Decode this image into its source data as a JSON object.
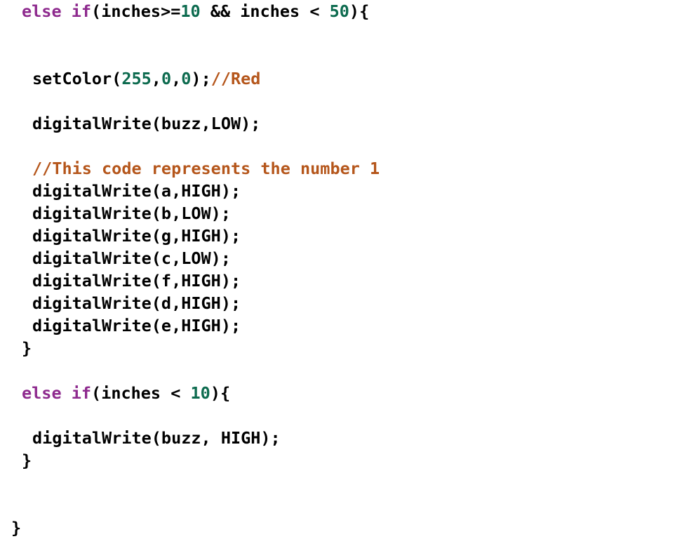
{
  "document": {
    "kind": "source-code-listing",
    "language": "arduino-c",
    "background_color": "#ffffff",
    "palette": {
      "keyword": "#8e2a8e",
      "number": "#0d6b4f",
      "comment": "#b5561b",
      "plain": "#000000"
    }
  },
  "code": {
    "lines": [
      {
        "id": "line-1",
        "indent": 1,
        "tokens": [
          {
            "type": "kw",
            "text": "else"
          },
          {
            "type": "plain",
            "text": " "
          },
          {
            "type": "kw",
            "text": "if"
          },
          {
            "type": "plain",
            "text": "(inches>="
          },
          {
            "type": "num",
            "text": "10"
          },
          {
            "type": "plain",
            "text": " && inches < "
          },
          {
            "type": "num",
            "text": "50"
          },
          {
            "type": "plain",
            "text": "){"
          }
        ]
      },
      {
        "id": "line-2",
        "indent": 0,
        "blank": true,
        "tokens": []
      },
      {
        "id": "line-3",
        "indent": 0,
        "blank": true,
        "tokens": []
      },
      {
        "id": "line-4",
        "indent": 2,
        "tokens": [
          {
            "type": "plain",
            "text": "setColor("
          },
          {
            "type": "num",
            "text": "255"
          },
          {
            "type": "plain",
            "text": ","
          },
          {
            "type": "num",
            "text": "0"
          },
          {
            "type": "plain",
            "text": ","
          },
          {
            "type": "num",
            "text": "0"
          },
          {
            "type": "plain",
            "text": ");"
          },
          {
            "type": "comment",
            "text": "//Red"
          }
        ]
      },
      {
        "id": "line-5",
        "indent": 0,
        "blank": true,
        "tokens": []
      },
      {
        "id": "line-6",
        "indent": 2,
        "tokens": [
          {
            "type": "plain",
            "text": "digitalWrite(buzz,LOW);"
          }
        ]
      },
      {
        "id": "line-7",
        "indent": 0,
        "blank": true,
        "tokens": []
      },
      {
        "id": "line-8",
        "indent": 2,
        "tokens": [
          {
            "type": "comment",
            "text": "//This code represents the number 1"
          }
        ]
      },
      {
        "id": "line-9",
        "indent": 2,
        "tokens": [
          {
            "type": "plain",
            "text": "digitalWrite(a,HIGH);"
          }
        ]
      },
      {
        "id": "line-10",
        "indent": 2,
        "tokens": [
          {
            "type": "plain",
            "text": "digitalWrite(b,LOW);"
          }
        ]
      },
      {
        "id": "line-11",
        "indent": 2,
        "tokens": [
          {
            "type": "plain",
            "text": "digitalWrite(g,HIGH);"
          }
        ]
      },
      {
        "id": "line-12",
        "indent": 2,
        "tokens": [
          {
            "type": "plain",
            "text": "digitalWrite(c,LOW);"
          }
        ]
      },
      {
        "id": "line-13",
        "indent": 2,
        "tokens": [
          {
            "type": "plain",
            "text": "digitalWrite(f,HIGH);"
          }
        ]
      },
      {
        "id": "line-14",
        "indent": 2,
        "tokens": [
          {
            "type": "plain",
            "text": "digitalWrite(d,HIGH);"
          }
        ]
      },
      {
        "id": "line-15",
        "indent": 2,
        "tokens": [
          {
            "type": "plain",
            "text": "digitalWrite(e,HIGH);"
          }
        ]
      },
      {
        "id": "line-16",
        "indent": 1,
        "tokens": [
          {
            "type": "plain",
            "text": "}"
          }
        ]
      },
      {
        "id": "line-17",
        "indent": 0,
        "blank": true,
        "tokens": []
      },
      {
        "id": "line-18",
        "indent": 1,
        "tokens": [
          {
            "type": "kw",
            "text": "else"
          },
          {
            "type": "plain",
            "text": " "
          },
          {
            "type": "kw",
            "text": "if"
          },
          {
            "type": "plain",
            "text": "(inches < "
          },
          {
            "type": "num",
            "text": "10"
          },
          {
            "type": "plain",
            "text": "){"
          }
        ]
      },
      {
        "id": "line-19",
        "indent": 0,
        "blank": true,
        "tokens": []
      },
      {
        "id": "line-20",
        "indent": 2,
        "tokens": [
          {
            "type": "plain",
            "text": "digitalWrite(buzz, HIGH);"
          }
        ]
      },
      {
        "id": "line-21",
        "indent": 1,
        "tokens": [
          {
            "type": "plain",
            "text": "}"
          }
        ]
      },
      {
        "id": "line-22",
        "indent": 0,
        "blank": true,
        "tokens": []
      },
      {
        "id": "line-23",
        "indent": 0,
        "blank": true,
        "tokens": []
      },
      {
        "id": "line-24",
        "indent": 0,
        "tokens": [
          {
            "type": "plain",
            "text": "}"
          }
        ]
      }
    ]
  }
}
